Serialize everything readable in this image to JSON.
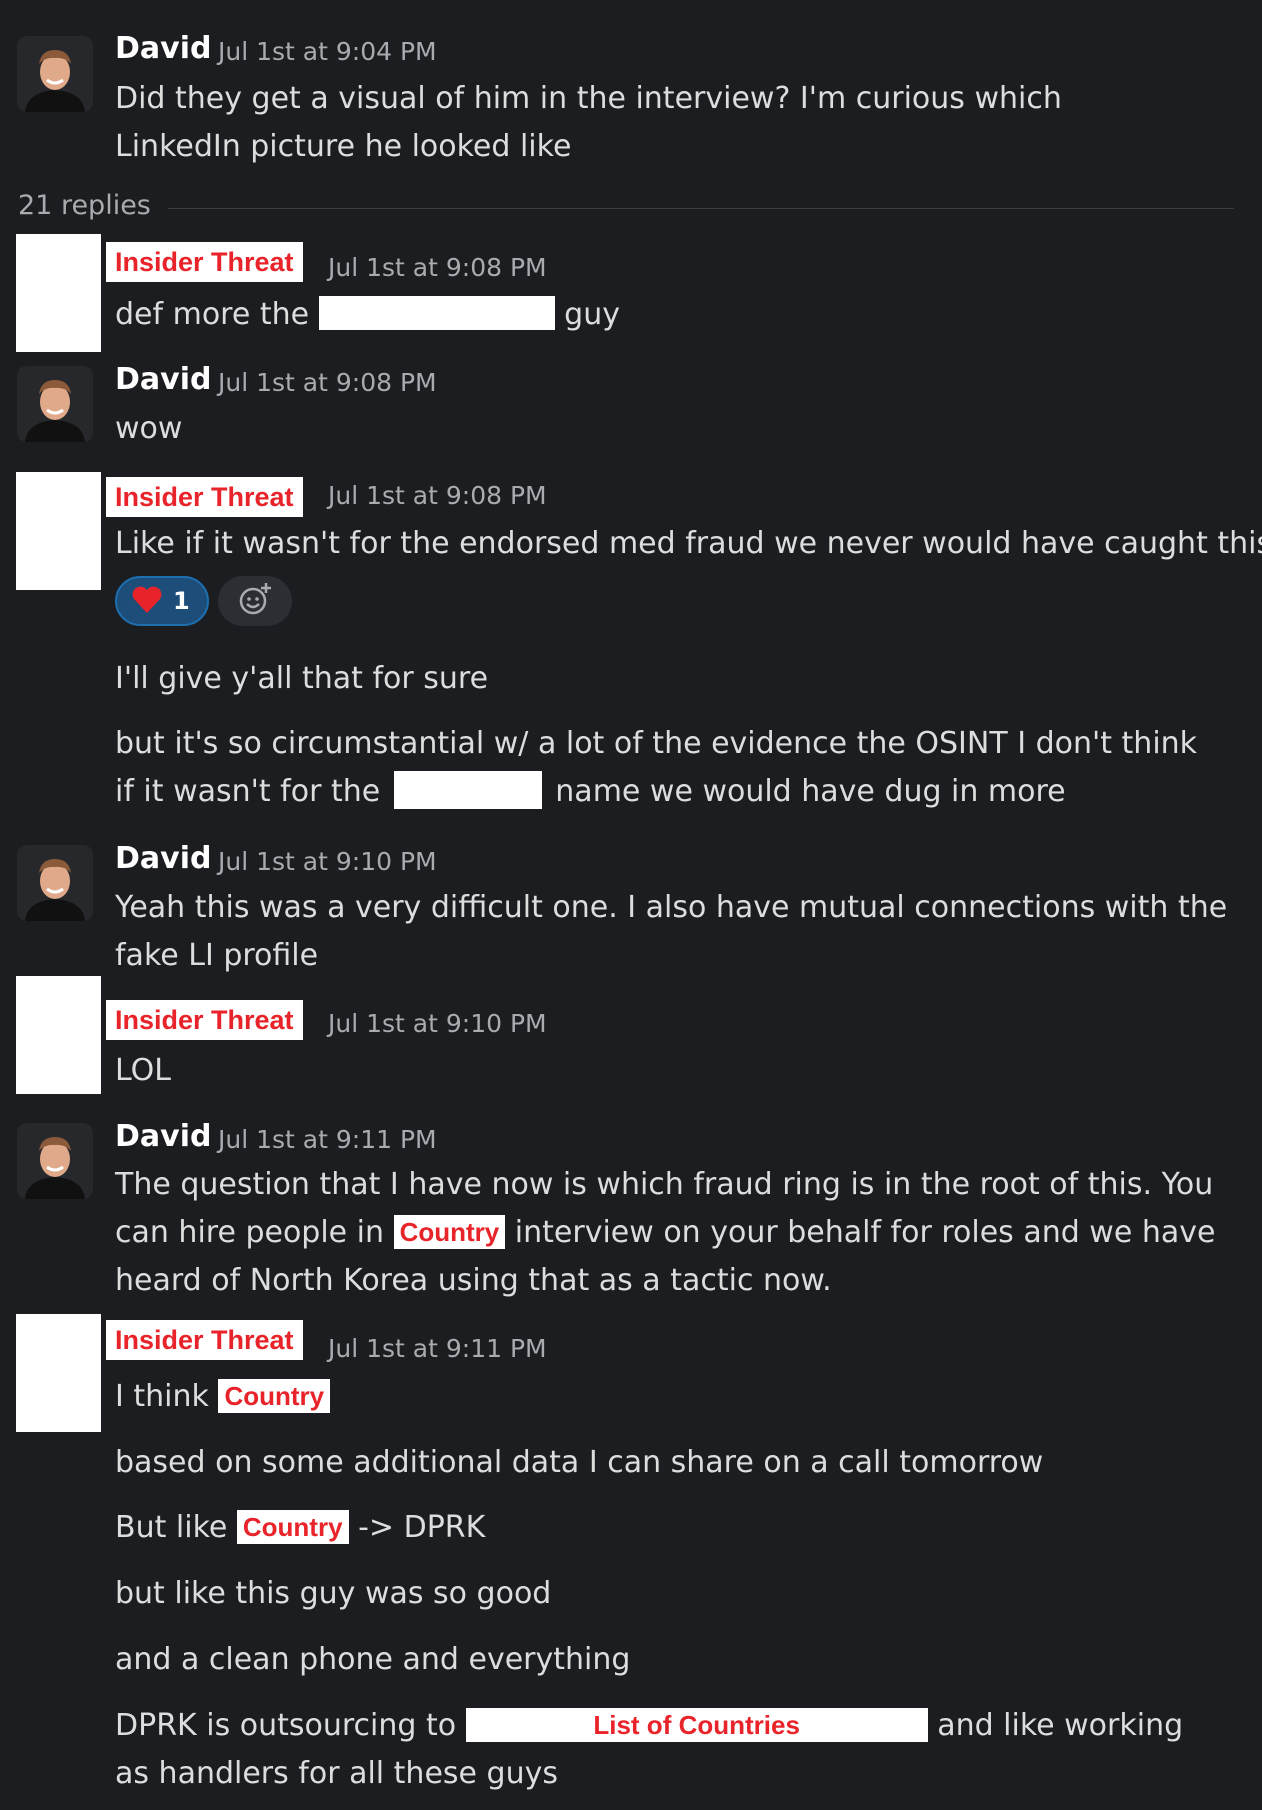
{
  "thread": {
    "replies_label": "21 replies"
  },
  "messages": [
    {
      "author": "David",
      "timestamp": "Jul 1st at 9:04 PM",
      "text": "Did they get a visual of him in the interview? I'm curious which LinkedIn picture he looked like"
    },
    {
      "author_tag": "Insider Threat",
      "timestamp": "Jul 1st at 9:08 PM",
      "text_before": "def more the",
      "text_after": "guy"
    },
    {
      "author": "David",
      "timestamp": "Jul 1st at 9:08 PM",
      "text": "wow"
    },
    {
      "author_tag": "Insider Threat",
      "timestamp": "Jul 1st at 9:08 PM",
      "text": "Like if it wasn't for the endorsed med fraud we never would have caught this",
      "reaction": {
        "emoji": "heart-icon",
        "count": "1",
        "color": "#1d4e7a"
      },
      "followups": [
        "I'll give y'all that for sure"
      ],
      "followup2_before": "but it's so circumstantial w/ a lot of the evidence the OSINT I don't think if it wasn't for the",
      "followup2_after": "name we would have dug in more"
    },
    {
      "author": "David",
      "timestamp": "Jul 1st at 9:10 PM",
      "text": "Yeah this was a very difficult one. I also have mutual connections with the fake LI profile"
    },
    {
      "author_tag": "Insider Threat",
      "timestamp": "Jul 1st at 9:10 PM",
      "text": "LOL"
    },
    {
      "author": "David",
      "timestamp": "Jul 1st at 9:11 PM",
      "text_before": "The question that I have now is which fraud ring is in the root of this. You can hire people in",
      "country_tag": "Country",
      "text_after": "interview on your behalf for roles and we have heard of North Korea using that as a tactic now."
    },
    {
      "author_tag": "Insider Threat",
      "timestamp": "Jul 1st at 9:11 PM",
      "line1_before": "I think",
      "country_tag": "Country",
      "line2": "based on some additional data I can share on a call tomorrow",
      "line3_before": "But like",
      "line3_after": "-> DPRK",
      "line4": "but like this guy was so good",
      "line5": "and a clean phone and everything",
      "line6_before": "DPRK is outsourcing to",
      "list_tag": "List of Countries",
      "line6_after": "and like working as handlers for all these guys"
    }
  ],
  "colors": {
    "background": "#1b1d21",
    "tag_red": "#e8232a",
    "reaction_blue": "#1d4e7a"
  }
}
